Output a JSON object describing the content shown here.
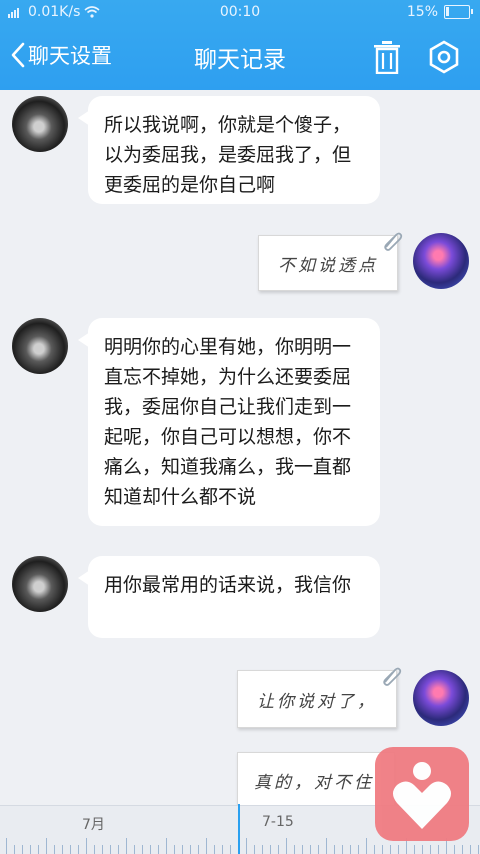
{
  "status": {
    "network_speed": "0.01K/s",
    "time": "00:10",
    "battery_text": "15%",
    "battery_level": 0.15
  },
  "nav": {
    "back_label": "聊天设置",
    "title": "聊天记录"
  },
  "messages": [
    {
      "text": "所以我说啊，你就是个傻子，以为委屈我，是委屈我了，但更委屈的是你自己啊"
    },
    {
      "text": "不如说透点"
    },
    {
      "text": "明明你的心里有她，你明明一直忘不掉她，为什么还要委屈我，委屈你自己让我们走到一起呢，你自己可以想想，你不痛么，知道我痛么，我一直都知道却什么都不说"
    },
    {
      "text": "用你最常用的话来说，我信你"
    },
    {
      "text": "让你说对了，"
    },
    {
      "text": "真的，对不住"
    }
  ],
  "timeline": {
    "labels": [
      "7月",
      "7-15"
    ]
  },
  "colors": {
    "accent": "#2e9ff0",
    "float_button": "#f07c82"
  }
}
